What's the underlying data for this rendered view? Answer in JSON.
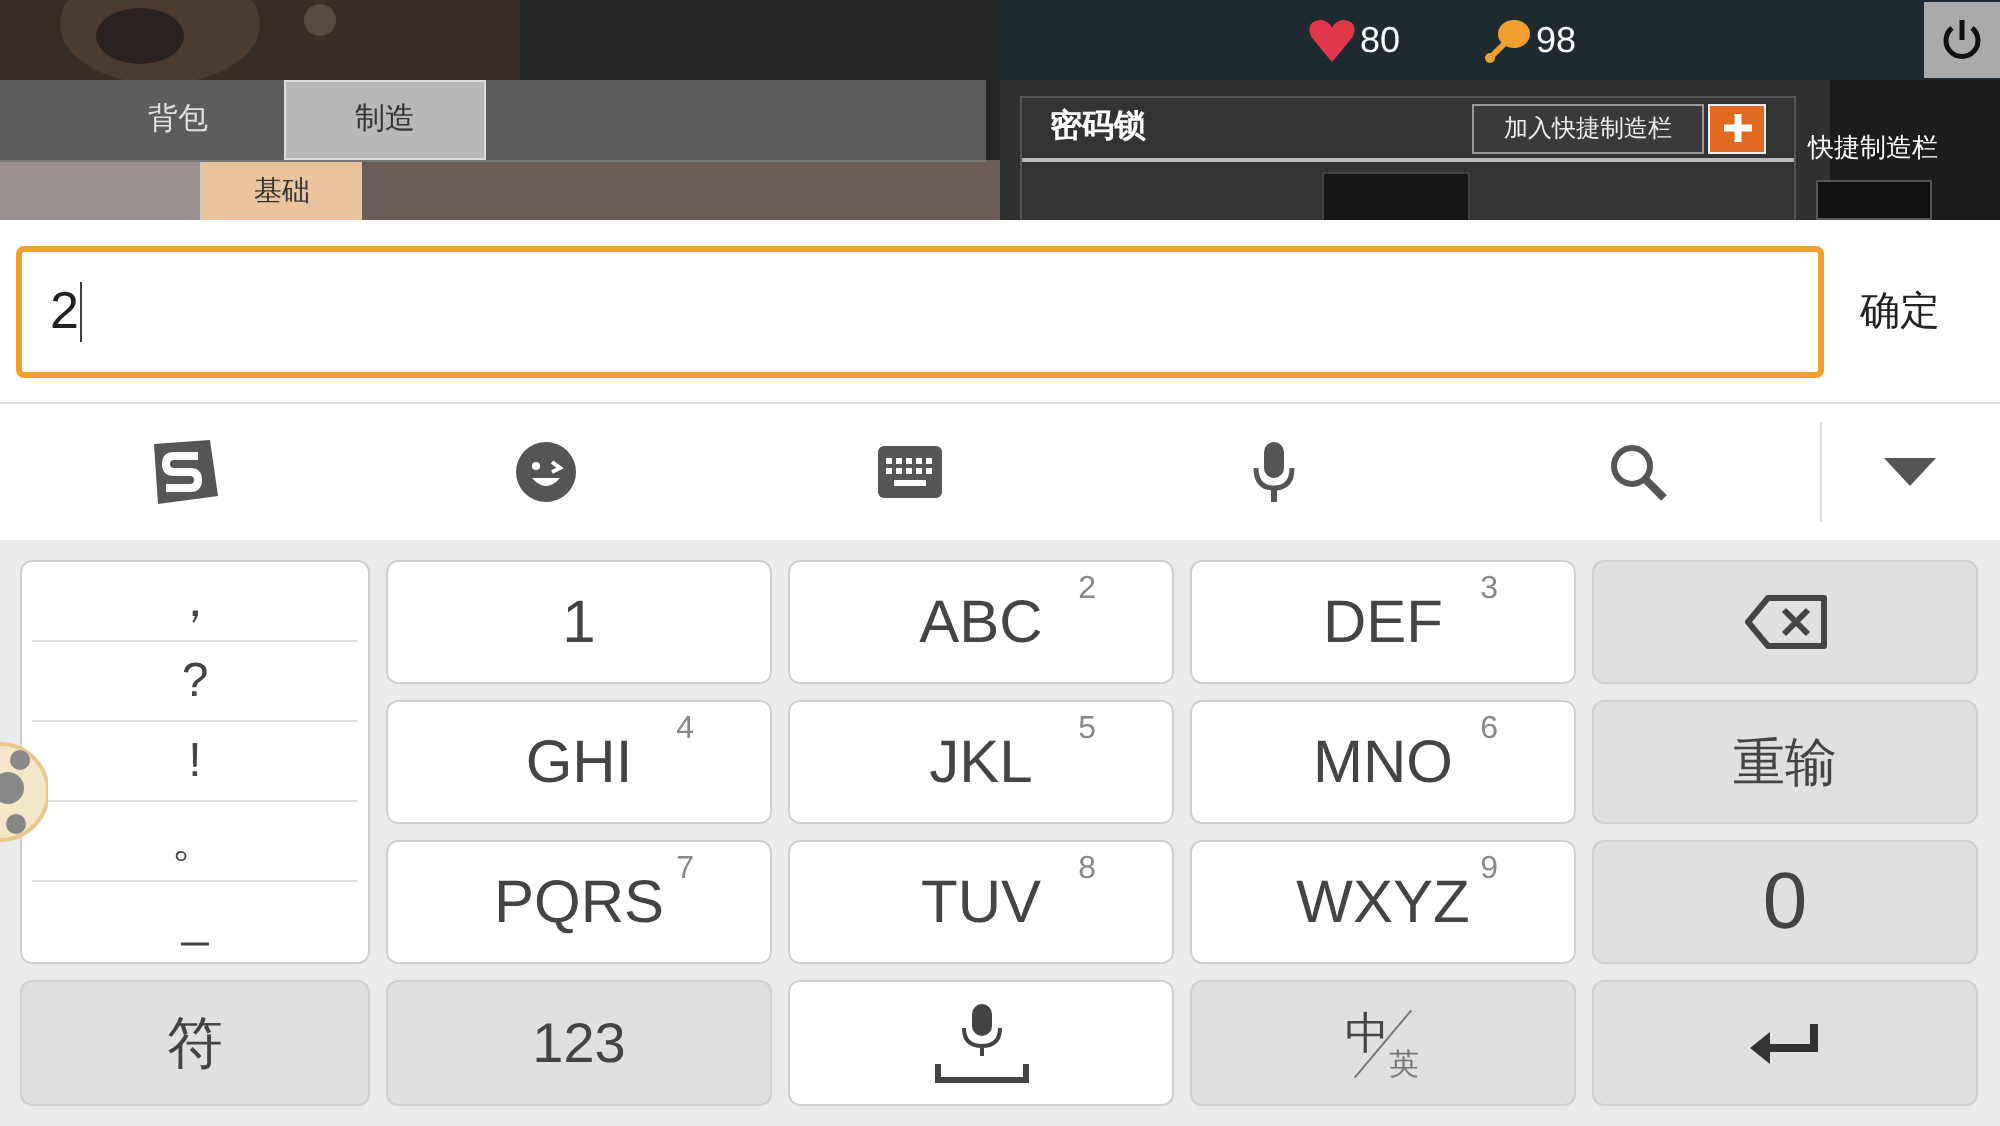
{
  "status": {
    "health": "80",
    "food": "98"
  },
  "game_tabs": [
    {
      "label": "背包",
      "selected": false
    },
    {
      "label": "制造",
      "selected": true
    }
  ],
  "category_tab": {
    "label": "基础",
    "selected": true
  },
  "recipe": {
    "title": "密码锁",
    "add_button": "加入快捷制造栏"
  },
  "quick_bar_title": "快捷制造栏",
  "input": {
    "value": "2",
    "confirm": "确定"
  },
  "toolbar": [
    {
      "kind": "logo"
    },
    {
      "kind": "emoji"
    },
    {
      "kind": "keyboard"
    },
    {
      "kind": "mic"
    },
    {
      "kind": "search"
    },
    {
      "kind": "collapse"
    }
  ],
  "symbols": [
    "，",
    "?",
    "!",
    "。",
    "_"
  ],
  "keys": [
    {
      "kind": "char",
      "label": "1"
    },
    {
      "kind": "char",
      "label": "ABC",
      "sub": "2"
    },
    {
      "kind": "char",
      "label": "DEF",
      "sub": "3"
    },
    {
      "kind": "backspace"
    },
    {
      "kind": "char",
      "label": "GHI",
      "sub": "4"
    },
    {
      "kind": "char",
      "label": "JKL",
      "sub": "5"
    },
    {
      "kind": "char",
      "label": "MNO",
      "sub": "6"
    },
    {
      "kind": "func",
      "label": "重输"
    },
    {
      "kind": "char",
      "label": "PQRS",
      "sub": "7"
    },
    {
      "kind": "char",
      "label": "TUV",
      "sub": "8"
    },
    {
      "kind": "char",
      "label": "WXYZ",
      "sub": "9"
    },
    {
      "kind": "func",
      "label": "0"
    }
  ],
  "bottom_keys": [
    {
      "kind": "func",
      "label": "符"
    },
    {
      "kind": "func",
      "label": "123"
    },
    {
      "kind": "space"
    },
    {
      "kind": "lang",
      "label": "中",
      "sub": "英"
    },
    {
      "kind": "enter"
    }
  ]
}
